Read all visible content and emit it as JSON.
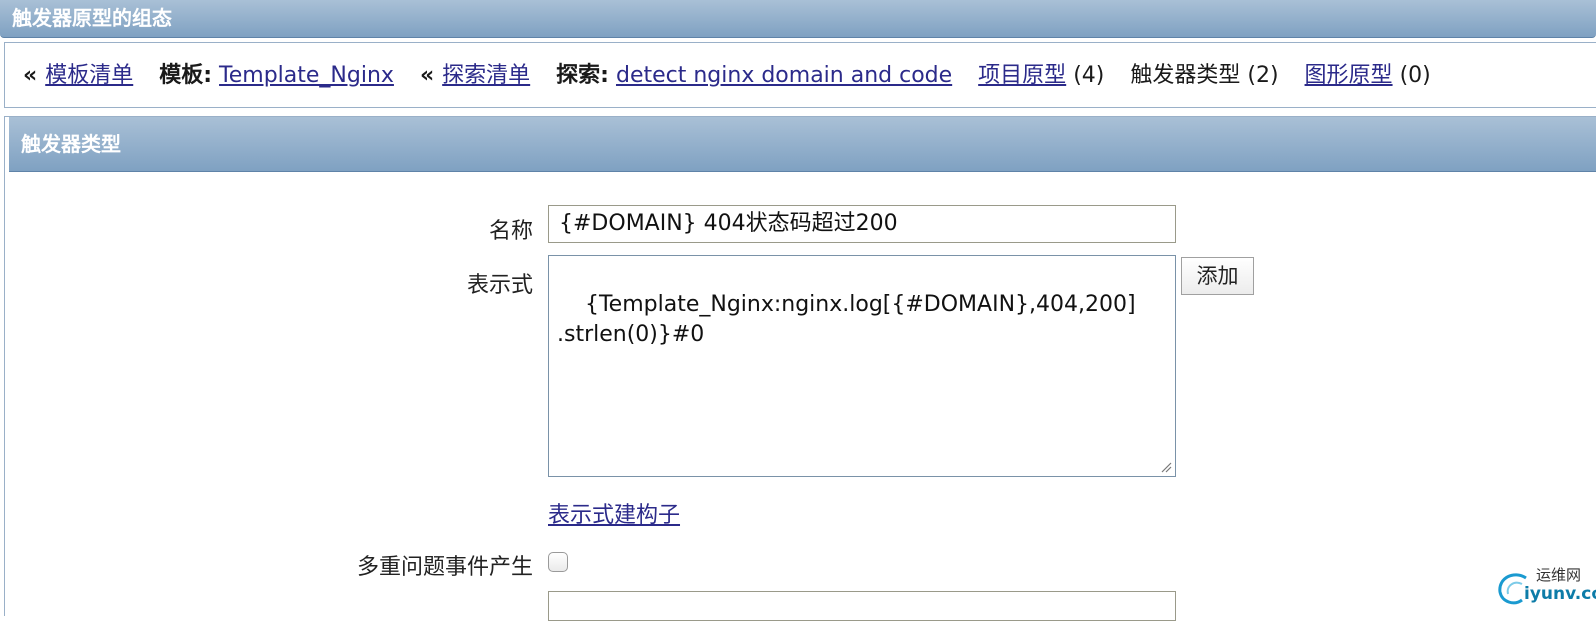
{
  "header": {
    "title": "触发器原型的组态"
  },
  "breadcrumb": {
    "sep": "«",
    "template_list": "模板清单",
    "template_label": "模板:",
    "template_name": "Template_Nginx",
    "discovery_list": "探索清单",
    "discovery_label": "探索:",
    "discovery_name": "detect nginx domain and code",
    "item_proto": "项目原型",
    "item_proto_count": "(4)",
    "trigger_types": "触发器类型",
    "trigger_types_count": "(2)",
    "graph_proto": "图形原型",
    "graph_proto_count": "(0)"
  },
  "form": {
    "section_title": "触发器类型",
    "name_label": "名称",
    "name_value": "{#DOMAIN} 404状态码超过200",
    "expr_label": "表示式",
    "expr_value": "{Template_Nginx:nginx.log[{#DOMAIN},404,200]\n.strlen(0)}#0",
    "add_button": "添加",
    "builder_link": "表示式建构子",
    "multiple_events_label": "多重问题事件产生"
  },
  "watermark": {
    "line1": "运维网",
    "line2": "iyunv.com"
  }
}
